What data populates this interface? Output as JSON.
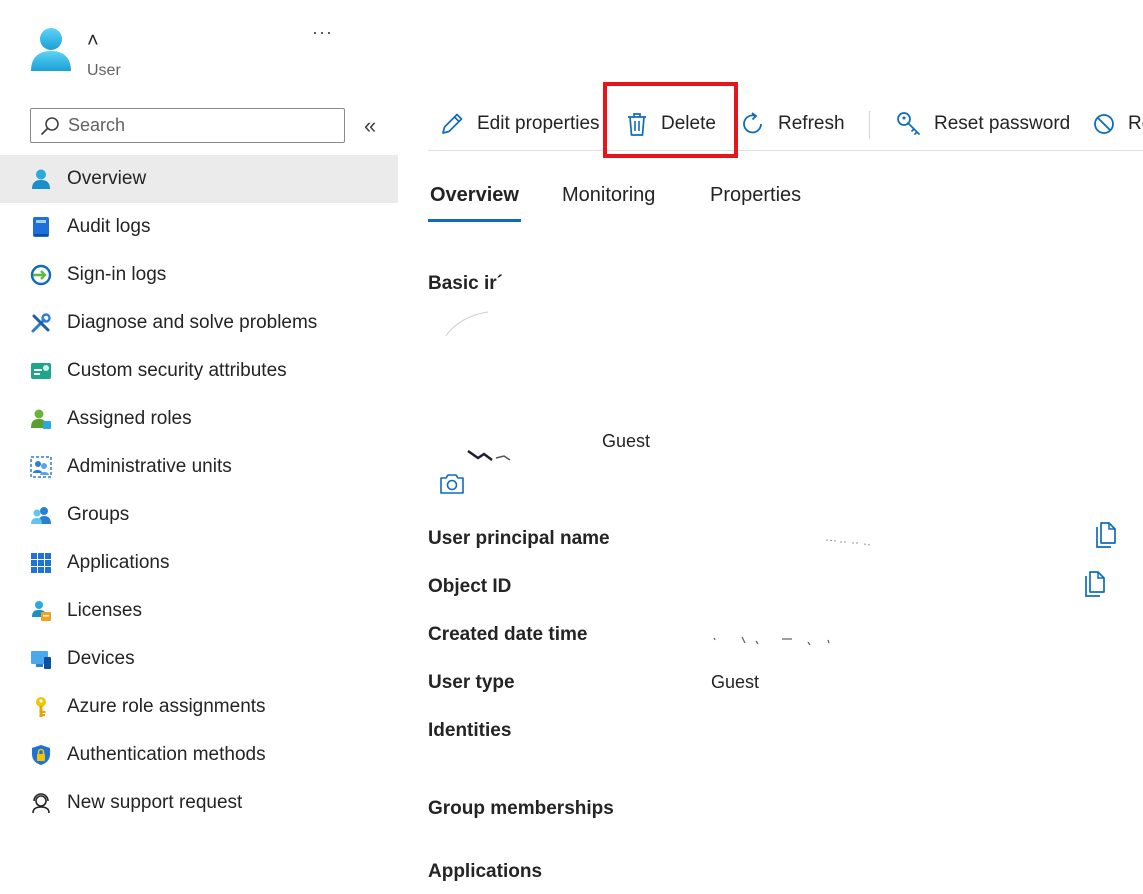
{
  "header": {
    "name": "˄",
    "subtitle": "User",
    "more_label": "···"
  },
  "search": {
    "placeholder": "Search"
  },
  "sidebar": {
    "items": [
      {
        "label": "Overview",
        "icon": "user-icon",
        "active": true
      },
      {
        "label": "Audit logs",
        "icon": "audit-log-icon"
      },
      {
        "label": "Sign-in logs",
        "icon": "sign-in-icon"
      },
      {
        "label": "Diagnose and solve problems",
        "icon": "wrench-icon"
      },
      {
        "label": "Custom security attributes",
        "icon": "security-attributes-icon"
      },
      {
        "label": "Assigned roles",
        "icon": "assigned-roles-icon"
      },
      {
        "label": "Administrative units",
        "icon": "admin-units-icon"
      },
      {
        "label": "Groups",
        "icon": "groups-icon"
      },
      {
        "label": "Applications",
        "icon": "applications-grid-icon"
      },
      {
        "label": "Licenses",
        "icon": "licenses-icon"
      },
      {
        "label": "Devices",
        "icon": "devices-icon"
      },
      {
        "label": "Azure role assignments",
        "icon": "key-icon"
      },
      {
        "label": "Authentication methods",
        "icon": "shield-lock-icon"
      },
      {
        "label": "New support request",
        "icon": "support-icon"
      }
    ]
  },
  "toolbar": {
    "edit_label": "Edit properties",
    "delete_label": "Delete",
    "refresh_label": "Refresh",
    "reset_password_label": "Reset password",
    "revoke_label": "Re"
  },
  "tabs": [
    {
      "label": "Overview",
      "active": true
    },
    {
      "label": "Monitoring"
    },
    {
      "label": "Properties"
    }
  ],
  "overview": {
    "section_title": "Basic ir´",
    "guest_tag": "Guest",
    "properties": [
      {
        "label": "User principal name",
        "value": ""
      },
      {
        "label": "Object ID",
        "value": ""
      },
      {
        "label": "Created date time",
        "value": ""
      },
      {
        "label": "User type",
        "value": "Guest"
      },
      {
        "label": "Identities",
        "value": ""
      }
    ],
    "group_memberships_label": "Group memberships",
    "applications_label": "Applications"
  },
  "colors": {
    "accent": "#0f6cbd",
    "highlight": "#e8141b",
    "active_nav": "#ebebeb"
  }
}
